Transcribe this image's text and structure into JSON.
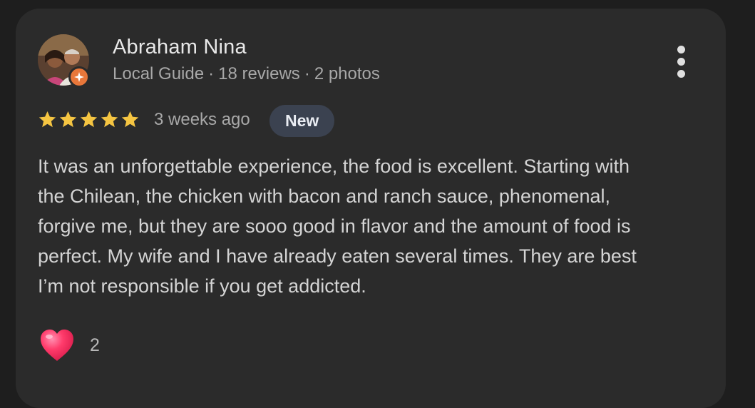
{
  "reviewer": {
    "name": "Abraham Nina",
    "badge": "Local Guide",
    "reviews": "18 reviews",
    "photos": "2 photos",
    "separator": "·",
    "avatar_icon": "user-photo",
    "badge_icon": "local-guide-star-icon"
  },
  "rating": {
    "stars": 5,
    "max_stars": 5,
    "star_color": "#f5c542",
    "time_ago": "3 weeks ago",
    "new_label": "New"
  },
  "review": {
    "lines": [
      "It was an unforgettable experience, the food is excellent. Starting with",
      "the Chilean, the chicken with bacon and ranch sauce, phenomenal,",
      "forgive me, but they are sooo good in flavor and the amount of food is",
      "perfect. My wife and I have already eaten several times. They are best",
      "I’m not responsible if you get addicted."
    ]
  },
  "reactions": {
    "icon": "heart-icon",
    "count": "2"
  },
  "menu": {
    "icon": "more-vert-icon"
  },
  "colors": {
    "background": "#1e1e1e",
    "card": "#2b2b2b",
    "accent_badge": "#e8773a",
    "new_badge_bg": "#3b4250",
    "heart": "#ff3b6b"
  }
}
